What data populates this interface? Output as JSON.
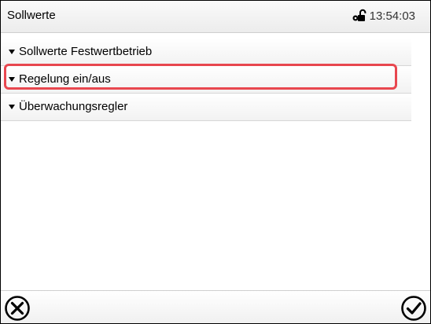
{
  "header": {
    "title": "Sollwerte",
    "time": "13:54:03",
    "lock_icon": "unlock-icon"
  },
  "menu": {
    "items": [
      {
        "label": "Sollwerte Festwertbetrieb",
        "icon": "triangle-down-icon"
      },
      {
        "label": "Regelung ein/aus",
        "icon": "triangle-down-icon",
        "highlighted": true
      },
      {
        "label": "Überwachungsregler",
        "icon": "triangle-down-icon"
      }
    ]
  },
  "footer": {
    "cancel_icon": "cancel-icon",
    "confirm_icon": "confirm-icon"
  },
  "colors": {
    "highlight": "#e8474f",
    "bar_top": "#fafafa",
    "bar_bottom": "#ececec"
  }
}
